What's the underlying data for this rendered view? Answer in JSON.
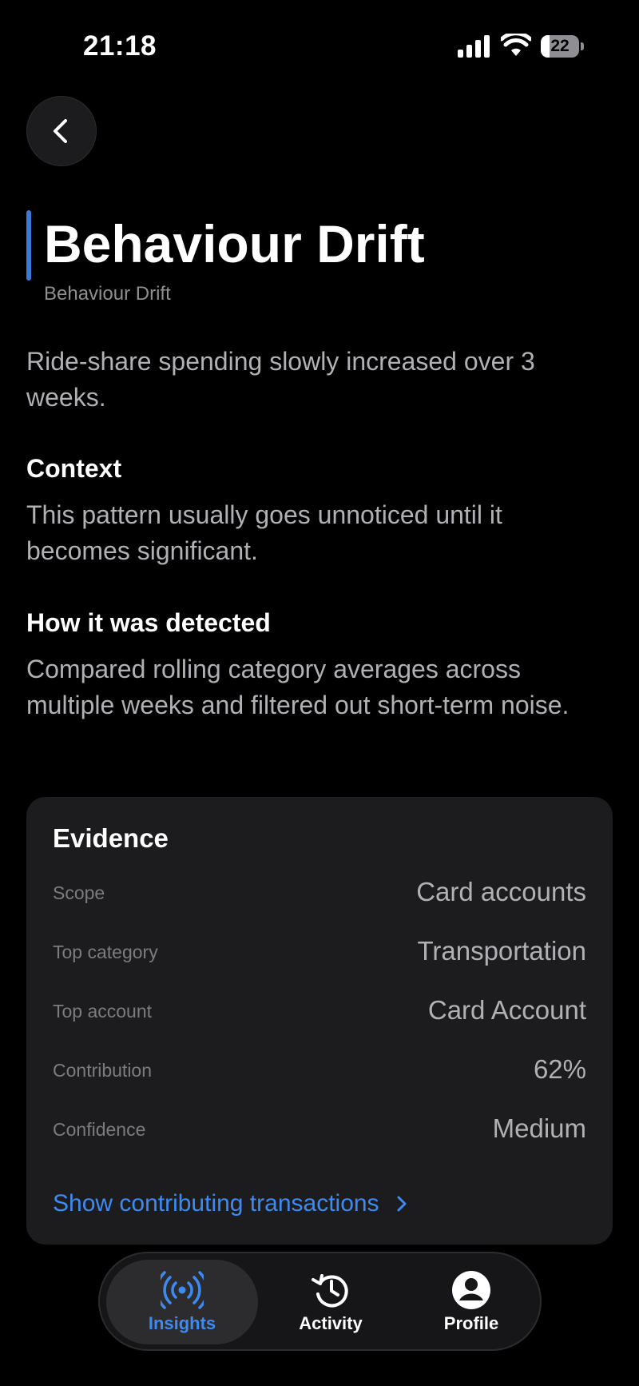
{
  "status_bar": {
    "time": "21:18",
    "battery_level": "22",
    "battery_fraction": 0.22
  },
  "header": {
    "back_icon": "chevron-left-icon",
    "title": "Behaviour Drift",
    "subtitle": "Behaviour Drift",
    "accent_color": "#3a7bd5"
  },
  "summary": "Ride-share spending slowly increased over 3 weeks.",
  "context": {
    "heading": "Context",
    "body": "This pattern usually goes unnoticed until it becomes significant."
  },
  "detection": {
    "heading": "How it was detected",
    "body": "Compared rolling category averages across multiple weeks and filtered out short-term noise."
  },
  "evidence": {
    "title": "Evidence",
    "rows": [
      {
        "label": "Scope",
        "value": "Card accounts"
      },
      {
        "label": "Top category",
        "value": "Transportation"
      },
      {
        "label": "Top account",
        "value": "Card Account"
      },
      {
        "label": "Contribution",
        "value": "62%"
      },
      {
        "label": "Confidence",
        "value": "Medium"
      }
    ],
    "link_label": "Show contributing transactions",
    "link_icon": "chevron-right-icon",
    "link_color": "#3d8bf2"
  },
  "tab_bar": {
    "tabs": [
      {
        "label": "Insights",
        "icon": "broadcast-icon",
        "active": true
      },
      {
        "label": "Activity",
        "icon": "history-clock-icon",
        "active": false
      },
      {
        "label": "Profile",
        "icon": "person-circle-icon",
        "active": false
      }
    ],
    "active_color": "#3d8bf2"
  }
}
